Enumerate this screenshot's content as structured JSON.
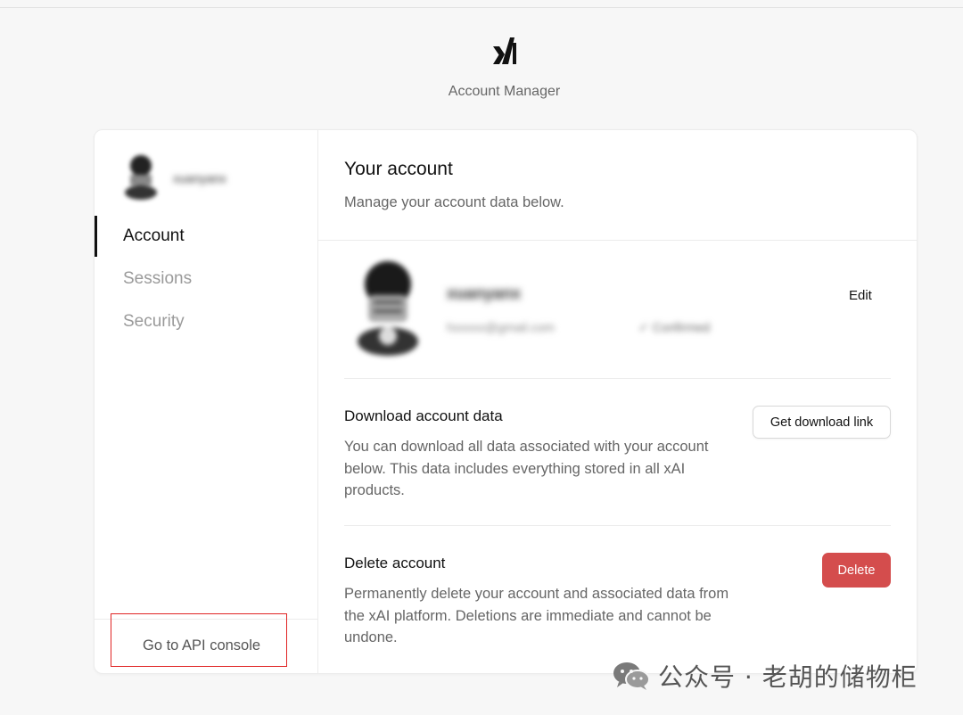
{
  "header": {
    "logo_icon": "xai-logo-icon",
    "app_title": "Account Manager"
  },
  "sidebar": {
    "user_name": "xuanyanx",
    "items": [
      {
        "label": "Account",
        "active": true
      },
      {
        "label": "Sessions",
        "active": false
      },
      {
        "label": "Security",
        "active": false
      }
    ],
    "footer_link": "Go to API console"
  },
  "main": {
    "title": "Your account",
    "subtitle": "Manage your account data below.",
    "profile": {
      "name": "xuanyanx",
      "email": "hxxxxx@gmail.com",
      "status": "✓ Confirmed",
      "edit_label": "Edit"
    },
    "download": {
      "title": "Download account data",
      "description": "You can download all data associated with your account below. This data includes everything stored in all xAI products.",
      "button_label": "Get download link"
    },
    "delete": {
      "title": "Delete account",
      "description": "Permanently delete your account and associated data from the xAI platform. Deletions are immediate and cannot be undone.",
      "button_label": "Delete"
    }
  },
  "colors": {
    "accent": "#111111",
    "danger": "#d44d4d",
    "highlight_box": "#e02424"
  },
  "watermark": {
    "icon": "wechat-icon",
    "text": "公众号 · 老胡的储物柜"
  }
}
